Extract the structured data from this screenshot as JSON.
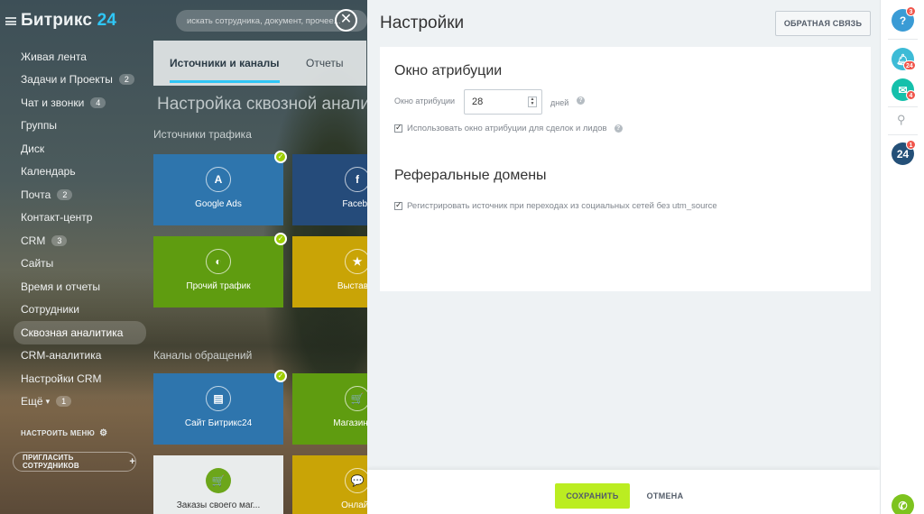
{
  "portal": {
    "logo_text": "Битрикс",
    "logo_num": "24",
    "search_placeholder": "искать сотрудника, документ, прочее...",
    "menu": [
      {
        "label": "Живая лента",
        "count": ""
      },
      {
        "label": "Задачи и Проекты",
        "count": "2"
      },
      {
        "label": "Чат и звонки",
        "count": "4"
      },
      {
        "label": "Группы",
        "count": ""
      },
      {
        "label": "Диск",
        "count": ""
      },
      {
        "label": "Календарь",
        "count": ""
      },
      {
        "label": "Почта",
        "count": "2"
      },
      {
        "label": "Контакт-центр",
        "count": ""
      },
      {
        "label": "CRM",
        "count": "3"
      },
      {
        "label": "Сайты",
        "count": ""
      },
      {
        "label": "Время и отчеты",
        "count": ""
      },
      {
        "label": "Сотрудники",
        "count": ""
      },
      {
        "label": "Сквозная аналитика",
        "count": ""
      },
      {
        "label": "CRM-аналитика",
        "count": ""
      },
      {
        "label": "Настройки CRM",
        "count": ""
      },
      {
        "label": "Ещё",
        "count": "1"
      }
    ],
    "menu_settings": "НАСТРОИТЬ МЕНЮ",
    "invite": "ПРИГЛАСИТЬ СОТРУДНИКОВ"
  },
  "underlying": {
    "tab_sources": "Источники и каналы",
    "tab_reports": "Отчеты",
    "title": "Настройка сквозной анализ",
    "section_sources": "Источники трафика",
    "section_channels": "Каналы обращений",
    "tiles": [
      {
        "label": "Google Ads",
        "icon": "A"
      },
      {
        "label": "Facebo",
        "icon": "f"
      },
      {
        "label": "Прочий трафик",
        "icon": "◐"
      },
      {
        "label": "Выставка",
        "icon": "★"
      },
      {
        "label": "Сайт Битрикс24",
        "icon": "▤"
      },
      {
        "label": "Магазин Би",
        "icon": "🛒"
      },
      {
        "label": "Заказы своего маг...",
        "icon": "🛒"
      },
      {
        "label": "Онлайн",
        "icon": "💬"
      }
    ]
  },
  "panel": {
    "title": "Настройки",
    "feedback": "ОБРАТНАЯ СВЯЗЬ",
    "attribution_heading": "Окно атрибуции",
    "attribution_label": "Окно атрибуции",
    "attribution_value": "28",
    "attribution_unit": "дней",
    "use_window_label": "Использовать окно атрибуции для сделок и лидов",
    "referral_heading": "Реферальные домены",
    "register_source_label": "Регистрировать источник при переходах из социальных сетей без utm_source",
    "save": "СОХРАНИТЬ",
    "cancel": "ОТМЕНА"
  },
  "rightbar": {
    "help_badge": "3",
    "notify_badge": "24",
    "chat_badge": "4",
    "b24_badge": "1",
    "b24_label": "24",
    "help_label": "?"
  },
  "colors": {
    "accent_blue": "#2fc6f6",
    "save_green": "#bbed21",
    "badge_red": "#f0554b"
  }
}
